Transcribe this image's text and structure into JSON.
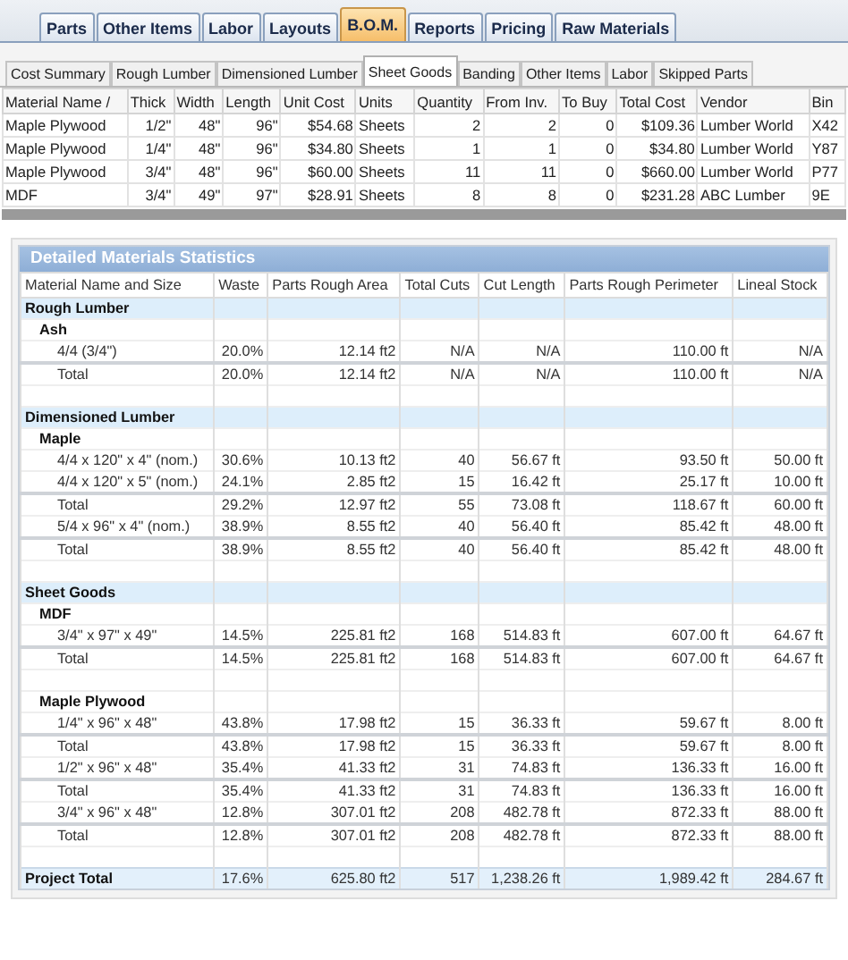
{
  "main_tabs": [
    {
      "label": "Parts",
      "selected": false
    },
    {
      "label": "Other Items",
      "selected": false
    },
    {
      "label": "Labor",
      "selected": false
    },
    {
      "label": "Layouts",
      "selected": false
    },
    {
      "label": "B.O.M.",
      "selected": true
    },
    {
      "label": "Reports",
      "selected": false
    },
    {
      "label": "Pricing",
      "selected": false
    },
    {
      "label": "Raw Materials",
      "selected": false
    }
  ],
  "sub_tabs": [
    {
      "label": "Cost Summary",
      "selected": false
    },
    {
      "label": "Rough Lumber",
      "selected": false
    },
    {
      "label": "Dimensioned Lumber",
      "selected": false
    },
    {
      "label": "Sheet Goods",
      "selected": true
    },
    {
      "label": "Banding",
      "selected": false
    },
    {
      "label": "Other Items",
      "selected": false
    },
    {
      "label": "Labor",
      "selected": false
    },
    {
      "label": "Skipped Parts",
      "selected": false
    }
  ],
  "materials_table": {
    "columns": [
      "Material Name /",
      "Thick",
      "Width",
      "Length",
      "Unit Cost",
      "Units",
      "Quantity",
      "From Inv.",
      "To Buy",
      "Total Cost",
      "Vendor",
      "Bin"
    ],
    "rows": [
      [
        "Maple Plywood",
        "1/2\"",
        "48\"",
        "96\"",
        "$54.68",
        "Sheets",
        "2",
        "2",
        "0",
        "$109.36",
        "Lumber World",
        "X42"
      ],
      [
        "Maple Plywood",
        "1/4\"",
        "48\"",
        "96\"",
        "$34.80",
        "Sheets",
        "1",
        "1",
        "0",
        "$34.80",
        "Lumber World",
        "Y87"
      ],
      [
        "Maple Plywood",
        "3/4\"",
        "48\"",
        "96\"",
        "$60.00",
        "Sheets",
        "11",
        "11",
        "0",
        "$660.00",
        "Lumber World",
        "P77"
      ],
      [
        "MDF",
        "3/4\"",
        "49\"",
        "97\"",
        "$28.91",
        "Sheets",
        "8",
        "8",
        "0",
        "$231.28",
        "ABC Lumber",
        "9E"
      ]
    ]
  },
  "statistics": {
    "title": "Detailed Materials Statistics",
    "columns": [
      "Material Name and Size",
      "Waste",
      "Parts Rough Area",
      "Total Cuts",
      "Cut Length",
      "Parts Rough Perimeter",
      "Lineal Stock"
    ],
    "rows": [
      {
        "kind": "category",
        "label": "Rough Lumber"
      },
      {
        "kind": "group",
        "label": "Ash"
      },
      {
        "kind": "item",
        "cells": [
          "4/4 (3/4\")",
          "20.0%",
          "12.14 ft2",
          "N/A",
          "N/A",
          "110.00 ft",
          "N/A"
        ]
      },
      {
        "kind": "total",
        "cells": [
          "Total",
          "20.0%",
          "12.14 ft2",
          "N/A",
          "N/A",
          "110.00 ft",
          "N/A"
        ]
      },
      {
        "kind": "blank"
      },
      {
        "kind": "category",
        "label": "Dimensioned Lumber"
      },
      {
        "kind": "group",
        "label": "Maple"
      },
      {
        "kind": "item",
        "cells": [
          "4/4 x 120\" x 4\" (nom.)",
          "30.6%",
          "10.13 ft2",
          "40",
          "56.67 ft",
          "93.50 ft",
          "50.00 ft"
        ]
      },
      {
        "kind": "item",
        "cells": [
          "4/4 x 120\" x 5\" (nom.)",
          "24.1%",
          "2.85 ft2",
          "15",
          "16.42 ft",
          "25.17 ft",
          "10.00 ft"
        ]
      },
      {
        "kind": "total",
        "cells": [
          "Total",
          "29.2%",
          "12.97 ft2",
          "55",
          "73.08 ft",
          "118.67 ft",
          "60.00 ft"
        ]
      },
      {
        "kind": "item",
        "cells": [
          "5/4 x 96\" x 4\" (nom.)",
          "38.9%",
          "8.55 ft2",
          "40",
          "56.40 ft",
          "85.42 ft",
          "48.00 ft"
        ]
      },
      {
        "kind": "total",
        "cells": [
          "Total",
          "38.9%",
          "8.55 ft2",
          "40",
          "56.40 ft",
          "85.42 ft",
          "48.00 ft"
        ]
      },
      {
        "kind": "blank"
      },
      {
        "kind": "category",
        "label": "Sheet Goods"
      },
      {
        "kind": "group",
        "label": "MDF"
      },
      {
        "kind": "item",
        "cells": [
          "3/4\" x 97\" x 49\"",
          "14.5%",
          "225.81 ft2",
          "168",
          "514.83 ft",
          "607.00 ft",
          "64.67 ft"
        ]
      },
      {
        "kind": "total",
        "cells": [
          "Total",
          "14.5%",
          "225.81 ft2",
          "168",
          "514.83 ft",
          "607.00 ft",
          "64.67 ft"
        ]
      },
      {
        "kind": "blank"
      },
      {
        "kind": "group",
        "label": "Maple Plywood"
      },
      {
        "kind": "item",
        "cells": [
          "1/4\" x 96\" x 48\"",
          "43.8%",
          "17.98 ft2",
          "15",
          "36.33 ft",
          "59.67 ft",
          "8.00 ft"
        ]
      },
      {
        "kind": "total",
        "cells": [
          "Total",
          "43.8%",
          "17.98 ft2",
          "15",
          "36.33 ft",
          "59.67 ft",
          "8.00 ft"
        ]
      },
      {
        "kind": "item",
        "cells": [
          "1/2\" x 96\" x 48\"",
          "35.4%",
          "41.33 ft2",
          "31",
          "74.83 ft",
          "136.33 ft",
          "16.00 ft"
        ]
      },
      {
        "kind": "total",
        "cells": [
          "Total",
          "35.4%",
          "41.33 ft2",
          "31",
          "74.83 ft",
          "136.33 ft",
          "16.00 ft"
        ]
      },
      {
        "kind": "item",
        "cells": [
          "3/4\" x 96\" x 48\"",
          "12.8%",
          "307.01 ft2",
          "208",
          "482.78 ft",
          "872.33 ft",
          "88.00 ft"
        ]
      },
      {
        "kind": "total",
        "cells": [
          "Total",
          "12.8%",
          "307.01 ft2",
          "208",
          "482.78 ft",
          "872.33 ft",
          "88.00 ft"
        ]
      },
      {
        "kind": "blank"
      },
      {
        "kind": "grand",
        "cells": [
          "Project Total",
          "17.6%",
          "625.80 ft2",
          "517",
          "1,238.26 ft",
          "1,989.42 ft",
          "284.67 ft"
        ]
      }
    ]
  }
}
